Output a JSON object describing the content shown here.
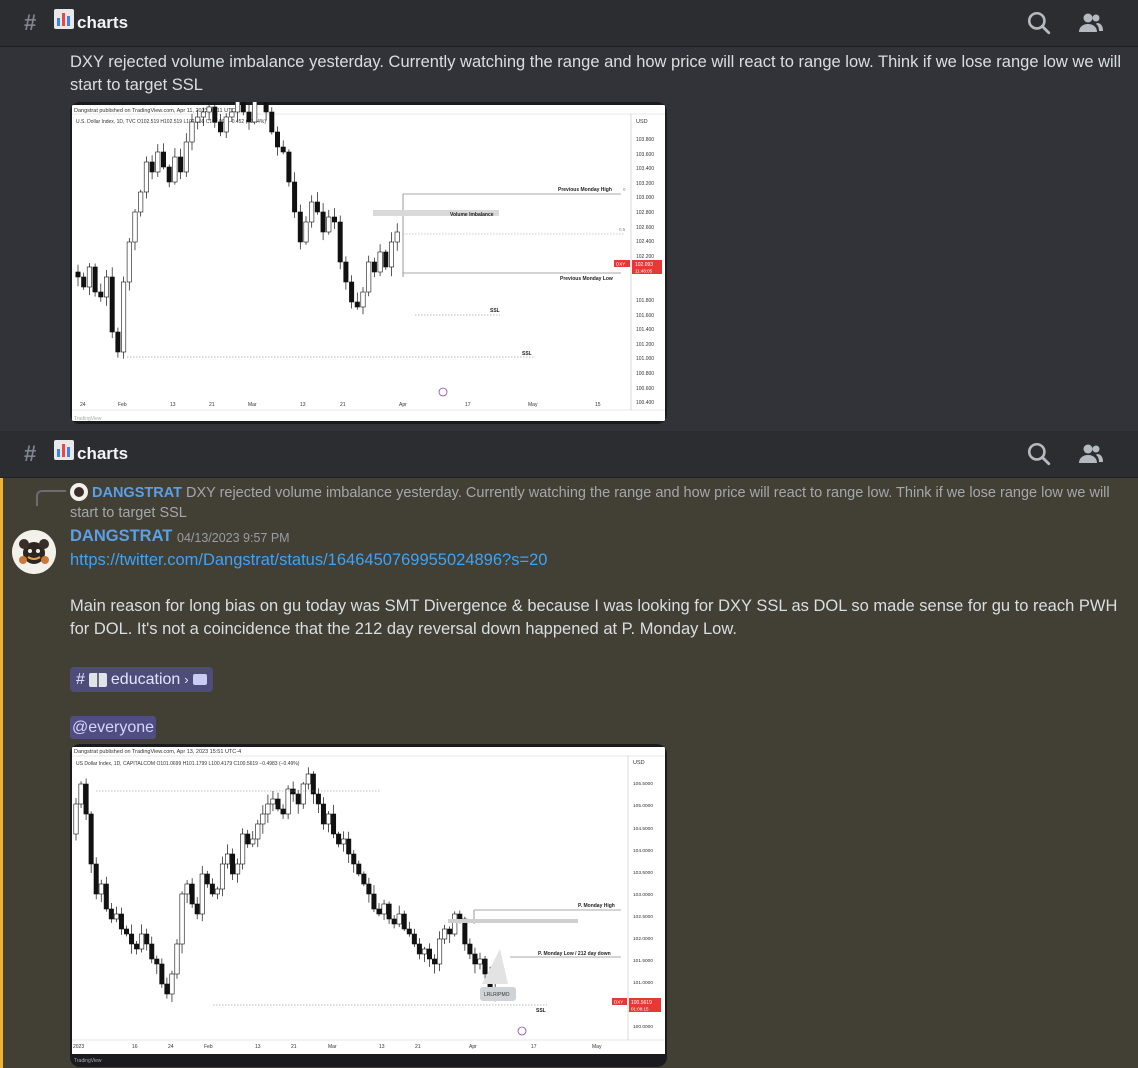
{
  "channel": {
    "hash": "#",
    "name": "charts"
  },
  "message1": {
    "text": "DXY rejected volume imbalance yesterday. Currently watching the range and how price will react to range low. Think if we lose range low we will start to target SSL"
  },
  "chart1": {
    "publisher": "Dangstrat published on TradingView.com, Apr 11, 2023 07:11 UTC-4",
    "symbol_line": "U.S. Dollar Index, 1D, TVC  O102.519  H102.519  L102.056  C102.093  −0.452 (−0.44%)",
    "currency": "USD",
    "y_ticks": [
      "103.800",
      "103.600",
      "103.400",
      "103.200",
      "103.000",
      "102.800",
      "102.600",
      "102.400",
      "102.200",
      "101.800",
      "101.600",
      "101.400",
      "101.200",
      "101.000",
      "100.800",
      "100.600",
      "100.400"
    ],
    "x_ticks": [
      "24",
      "Feb",
      "13",
      "21",
      "Mar",
      "13",
      "21",
      "Apr",
      "17",
      "May",
      "15"
    ],
    "labels": {
      "prev_monday_high": "Previous Monday High",
      "volume_imbalance": "Volume Imbalance",
      "prev_monday_low": "Previous Monday Low",
      "ssl_1": "SSL",
      "ssl_2": "SSL",
      "fib_0": "0",
      "fib_05": "0.5"
    },
    "price_tag_symbol": "DXY",
    "price_tag_value": "102.093",
    "price_tag_time": "11:48:05",
    "footer": "TradingView"
  },
  "reply": {
    "name": "DANGSTRAT",
    "text": "DXY rejected volume imbalance yesterday. Currently watching the range and how price will react to range low. Think if we lose range low we will start to target SSL"
  },
  "message2": {
    "author": "DANGSTRAT",
    "timestamp": "04/13/2023 9:57 PM",
    "link": "https://twitter.com/Dangstrat/status/1646450769955024896?s=20",
    "text": "Main reason for long bias on gu today was SMT Divergence & because I was looking for DXY SSL as DOL so made sense for gu to reach PWH for DOL. It's not a coincidence that the 212 day reversal down happened at P. Monday Low.",
    "channel_pill": "education",
    "mention": "@everyone"
  },
  "chart2": {
    "publisher": "Dangstrat published on TradingView.com, Apr 13, 2023 15:51 UTC-4",
    "symbol_line": "US Dollar Index, 1D, CAPITALCOM  O101.0699  H101.1799  L100.4179  C100.5619  −0.4983 (−0.49%)",
    "currency": "USD",
    "y_ticks": [
      "105.5000",
      "105.0000",
      "104.5000",
      "104.0000",
      "103.5000",
      "103.0000",
      "102.5000",
      "102.0000",
      "101.5000",
      "101.0000",
      "100.0000"
    ],
    "x_ticks": [
      "2023",
      "16",
      "24",
      "Feb",
      "13",
      "21",
      "Mar",
      "13",
      "21",
      "Apr",
      "17",
      "May"
    ],
    "labels": {
      "p_monday_high": "P. Monday High",
      "p_monday_low": "P. Monday Low / 212 day down",
      "callout": "LRLR/PMO",
      "ssl": "SSL"
    },
    "price_tag_symbol": "DXY",
    "price_tag_value": "100.5619",
    "price_tag_time": "01:08:15",
    "footer": "TradingView"
  },
  "colors": {
    "bg": "#313338",
    "topbar": "#2b2d31",
    "reply_highlight": "#423f35",
    "accent_bar": "#f0b232",
    "author": "#5aa0e8",
    "link": "#3ea3f5",
    "price_tag": "#e53935"
  },
  "icons": [
    "hash-icon",
    "chart-emoji-icon",
    "search-icon",
    "members-icon",
    "book-emoji-icon",
    "chevron-right-icon",
    "thread-icon"
  ]
}
